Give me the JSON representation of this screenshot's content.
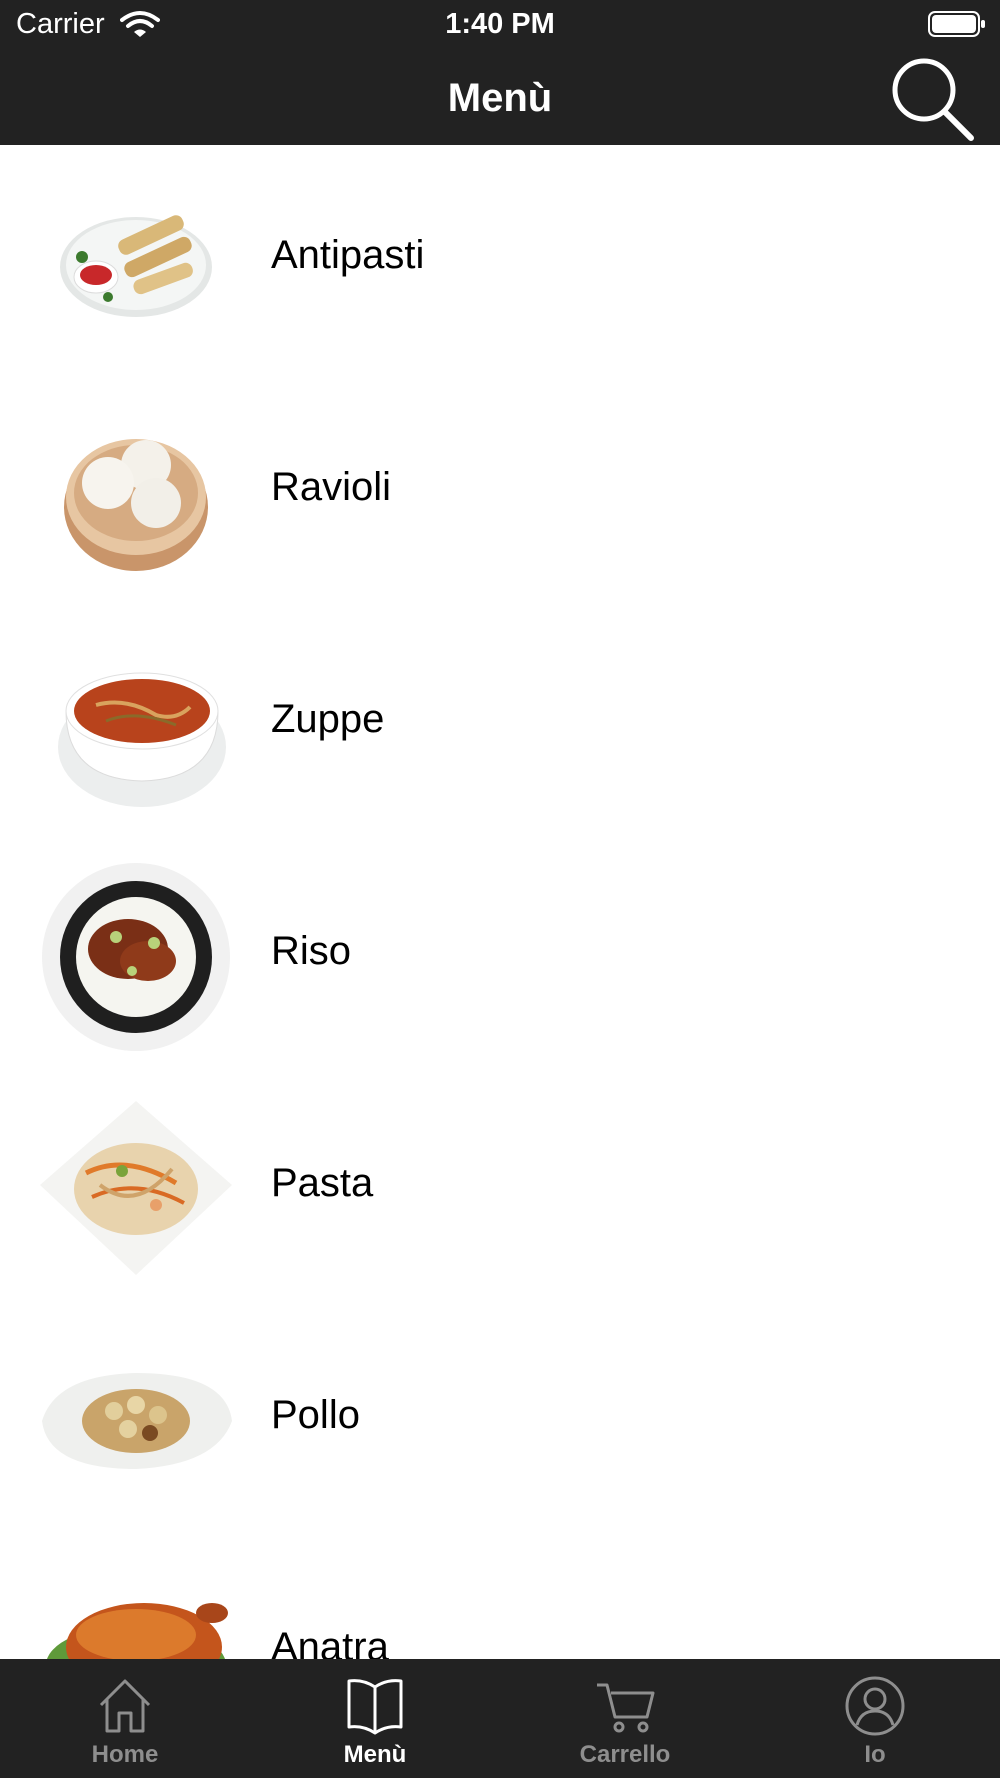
{
  "status_bar": {
    "carrier": "Carrier",
    "time": "1:40 PM"
  },
  "nav": {
    "title": "Menù",
    "search_icon": "search-icon"
  },
  "menu": {
    "items": [
      {
        "label": "Antipasti",
        "icon": "spring-rolls-plate"
      },
      {
        "label": "Ravioli",
        "icon": "steamed-buns-basket"
      },
      {
        "label": "Zuppe",
        "icon": "soup-bowl"
      },
      {
        "label": "Riso",
        "icon": "rice-bowl"
      },
      {
        "label": "Pasta",
        "icon": "noodles-plate"
      },
      {
        "label": "Pollo",
        "icon": "chicken-plate"
      },
      {
        "label": "Anatra",
        "icon": "roast-duck"
      }
    ]
  },
  "tabbar": {
    "tabs": [
      {
        "label": "Home",
        "icon": "home-icon",
        "active": false
      },
      {
        "label": "Menù",
        "icon": "book-icon",
        "active": true
      },
      {
        "label": "Carrello",
        "icon": "cart-icon",
        "active": false
      },
      {
        "label": "Io",
        "icon": "user-icon",
        "active": false
      }
    ]
  },
  "colors": {
    "bar_background": "#222222",
    "tab_active": "#ffffff",
    "tab_inactive": "#8e8e8e"
  }
}
